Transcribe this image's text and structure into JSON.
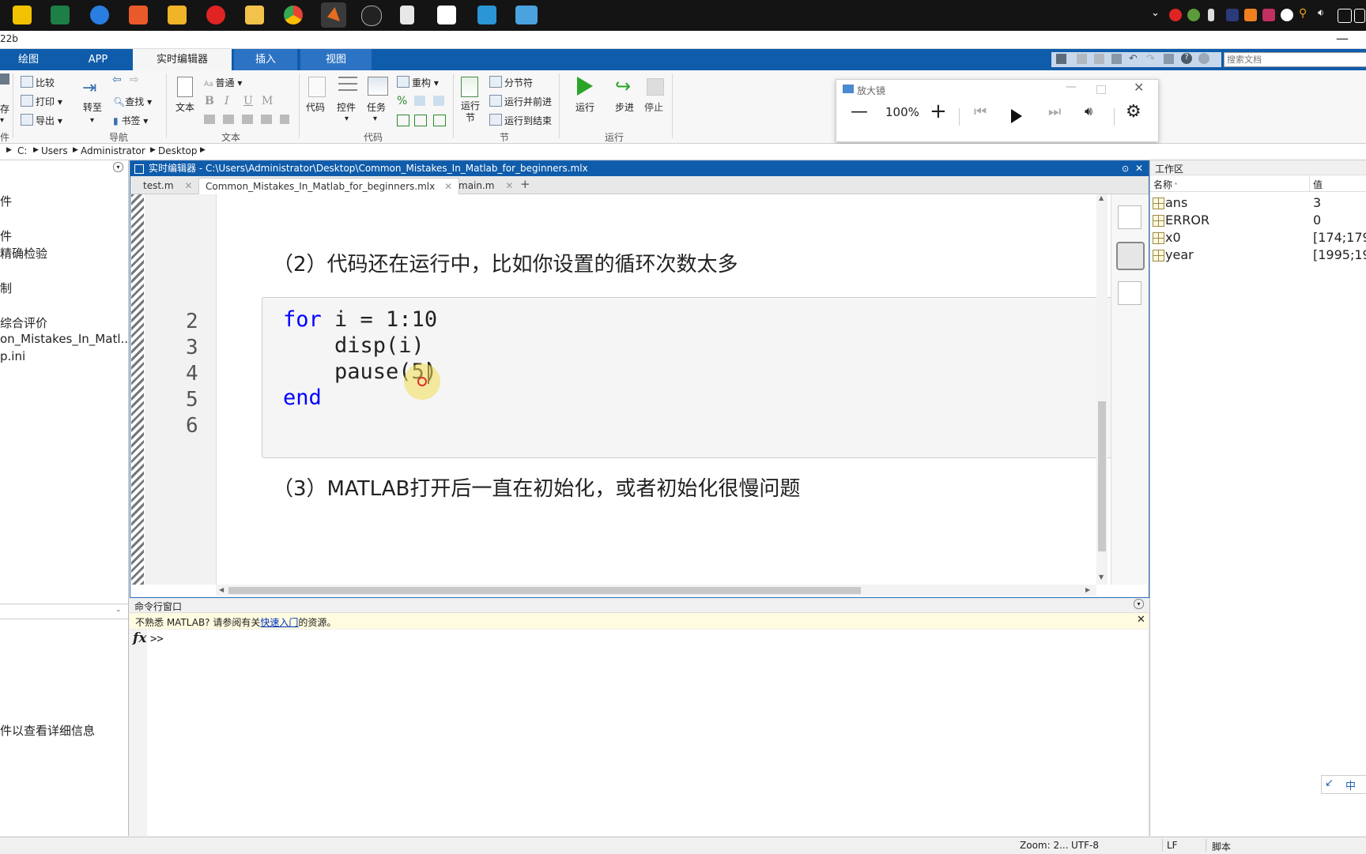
{
  "taskbar": {
    "apps": [
      {
        "icon": "notes-icon",
        "color": "#f2c200"
      },
      {
        "icon": "excel-icon",
        "color": "#1d7f45"
      },
      {
        "icon": "sogou-icon",
        "color": "#2a7de1"
      },
      {
        "icon": "audio-app-icon",
        "color": "#e85a2a"
      },
      {
        "icon": "folder-icon",
        "color": "#f0b429"
      },
      {
        "icon": "netease-music-icon",
        "color": "#e02424"
      },
      {
        "icon": "file-explorer-icon",
        "color": "#f2c24b"
      },
      {
        "icon": "chrome-icon",
        "color": "#34a853"
      },
      {
        "icon": "matlab-icon",
        "color": "#e86b1f"
      },
      {
        "icon": "qq-icon",
        "color": "#222222"
      },
      {
        "icon": "document-icon",
        "color": "#e8e8e8"
      },
      {
        "icon": "baidu-netdisk-icon",
        "color": "#3b82f6"
      },
      {
        "icon": "search-tool-icon",
        "color": "#2b95d6"
      },
      {
        "icon": "remote-desktop-icon",
        "color": "#4aa3df"
      }
    ]
  },
  "window": {
    "title": "22b"
  },
  "ribbon": {
    "tabs": [
      "绘图",
      "APP",
      "实时编辑器",
      "插入",
      "视图"
    ],
    "active_tab": "实时编辑器",
    "search_placeholder": "搜索文档",
    "file_items": [
      "存",
      "件"
    ],
    "nav": {
      "compare": "比较",
      "print": "打印",
      "export": "导出",
      "goto": "转至",
      "find": "查找",
      "bookmark": "书签",
      "group": "导航"
    },
    "text": {
      "text_btn": "文本",
      "style": "普通",
      "bold": "B",
      "italic": "I",
      "underline": "U",
      "mono": "M",
      "group": "文本"
    },
    "code": {
      "code_btn": "代码",
      "control": "控件",
      "task": "任务",
      "refactor": "重构",
      "group": "代码"
    },
    "section": {
      "run_section": "运行节",
      "section_break": "分节符",
      "run_advance": "运行并前进",
      "run_to_end": "运行到结束",
      "group": "节"
    },
    "run": {
      "run": "运行",
      "step": "步进",
      "stop": "停止",
      "group": "运行"
    }
  },
  "magnifier": {
    "title": "放大镜",
    "zoom": "100%"
  },
  "address": {
    "path": [
      "C:",
      "Users",
      "Administrator",
      "Desktop"
    ]
  },
  "left_pane": {
    "items": [
      "件",
      "件",
      "精确检验",
      "制",
      "综合评价",
      "on_Mistakes_In_Matl..",
      "p.ini"
    ],
    "details_hint": "件以查看详细信息"
  },
  "editor": {
    "title": "实时编辑器 - C:\\Users\\Administrator\\Desktop\\Common_Mistakes_In_Matlab_for_beginners.mlx",
    "tabs": [
      "test.m",
      "Common_Mistakes_In_Matlab_for_beginners.mlx",
      "main.m"
    ],
    "active_tab": "Common_Mistakes_In_Matlab_for_beginners.mlx",
    "heading_2": "（2）代码还在运行中，比如你设置的循环次数太多",
    "line_numbers": [
      "2",
      "3",
      "4",
      "5",
      "6"
    ],
    "code": {
      "for_kw": "for",
      "for_rest": " i = 1:10",
      "line3": "    disp(i)",
      "line4": "    pause(5)",
      "end_kw": "end"
    },
    "heading_3": "（3）MATLAB打开后一直在初始化，或者初始化很慢问题"
  },
  "command_window": {
    "title": "命令行窗口",
    "notice_prefix": "不熟悉 MATLAB? 请参阅有关",
    "notice_link": "快速入门",
    "notice_suffix": "的资源。",
    "fx": "fx",
    "prompt": ">>"
  },
  "workspace": {
    "title": "工作区",
    "col_name": "名称",
    "col_value": "值",
    "rows": [
      {
        "name": "ans",
        "value": "3"
      },
      {
        "name": "ERROR",
        "value": "0"
      },
      {
        "name": "x0",
        "value": "[174;179;"
      },
      {
        "name": "year",
        "value": "[1995;19"
      }
    ],
    "ime": "中"
  },
  "status": {
    "zoom": "Zoom: 2...",
    "encoding": "UTF-8",
    "eol": "LF",
    "mode": "脚本"
  },
  "colors": {
    "accent": "#0f5cab",
    "keyword": "#0000ff",
    "run_green": "#2aa52a"
  }
}
